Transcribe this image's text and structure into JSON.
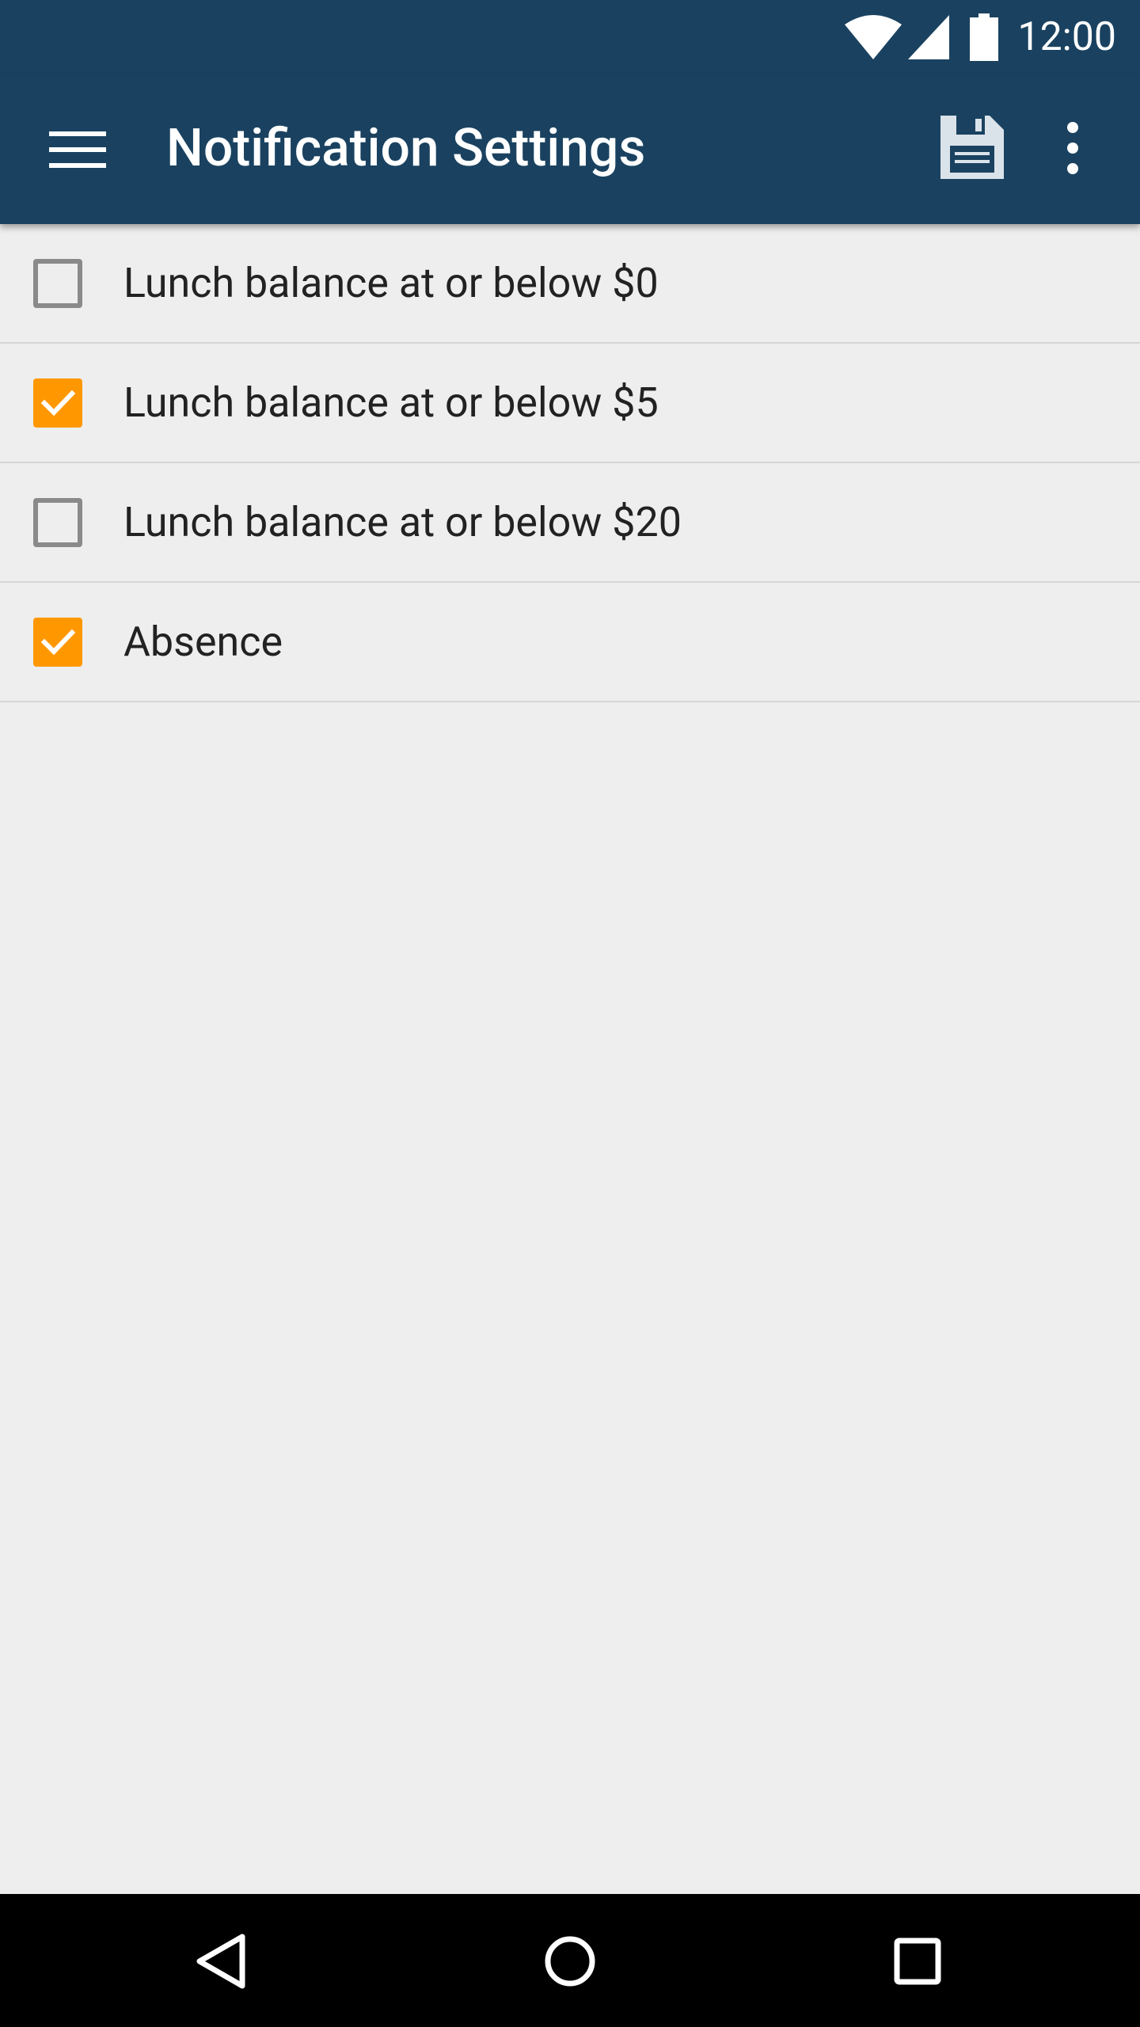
{
  "status_bar": {
    "time": "12:00",
    "icons": [
      "wifi-icon",
      "cell-signal-icon",
      "battery-icon"
    ]
  },
  "app_bar": {
    "title": "Notification Settings",
    "icons": [
      "menu-icon",
      "save-icon",
      "overflow-menu-icon"
    ]
  },
  "settings": [
    {
      "label": "Lunch balance at or below $0",
      "checked": false
    },
    {
      "label": "Lunch balance at or below $5",
      "checked": true
    },
    {
      "label": "Lunch balance at or below $20",
      "checked": false
    },
    {
      "label": "Absence",
      "checked": true
    }
  ],
  "nav_bar": {
    "icons": [
      "back-icon",
      "home-icon",
      "recent-apps-icon"
    ]
  },
  "colors": {
    "primary": "#1a4260",
    "accent": "#ff9800",
    "background": "#eeeeee"
  }
}
